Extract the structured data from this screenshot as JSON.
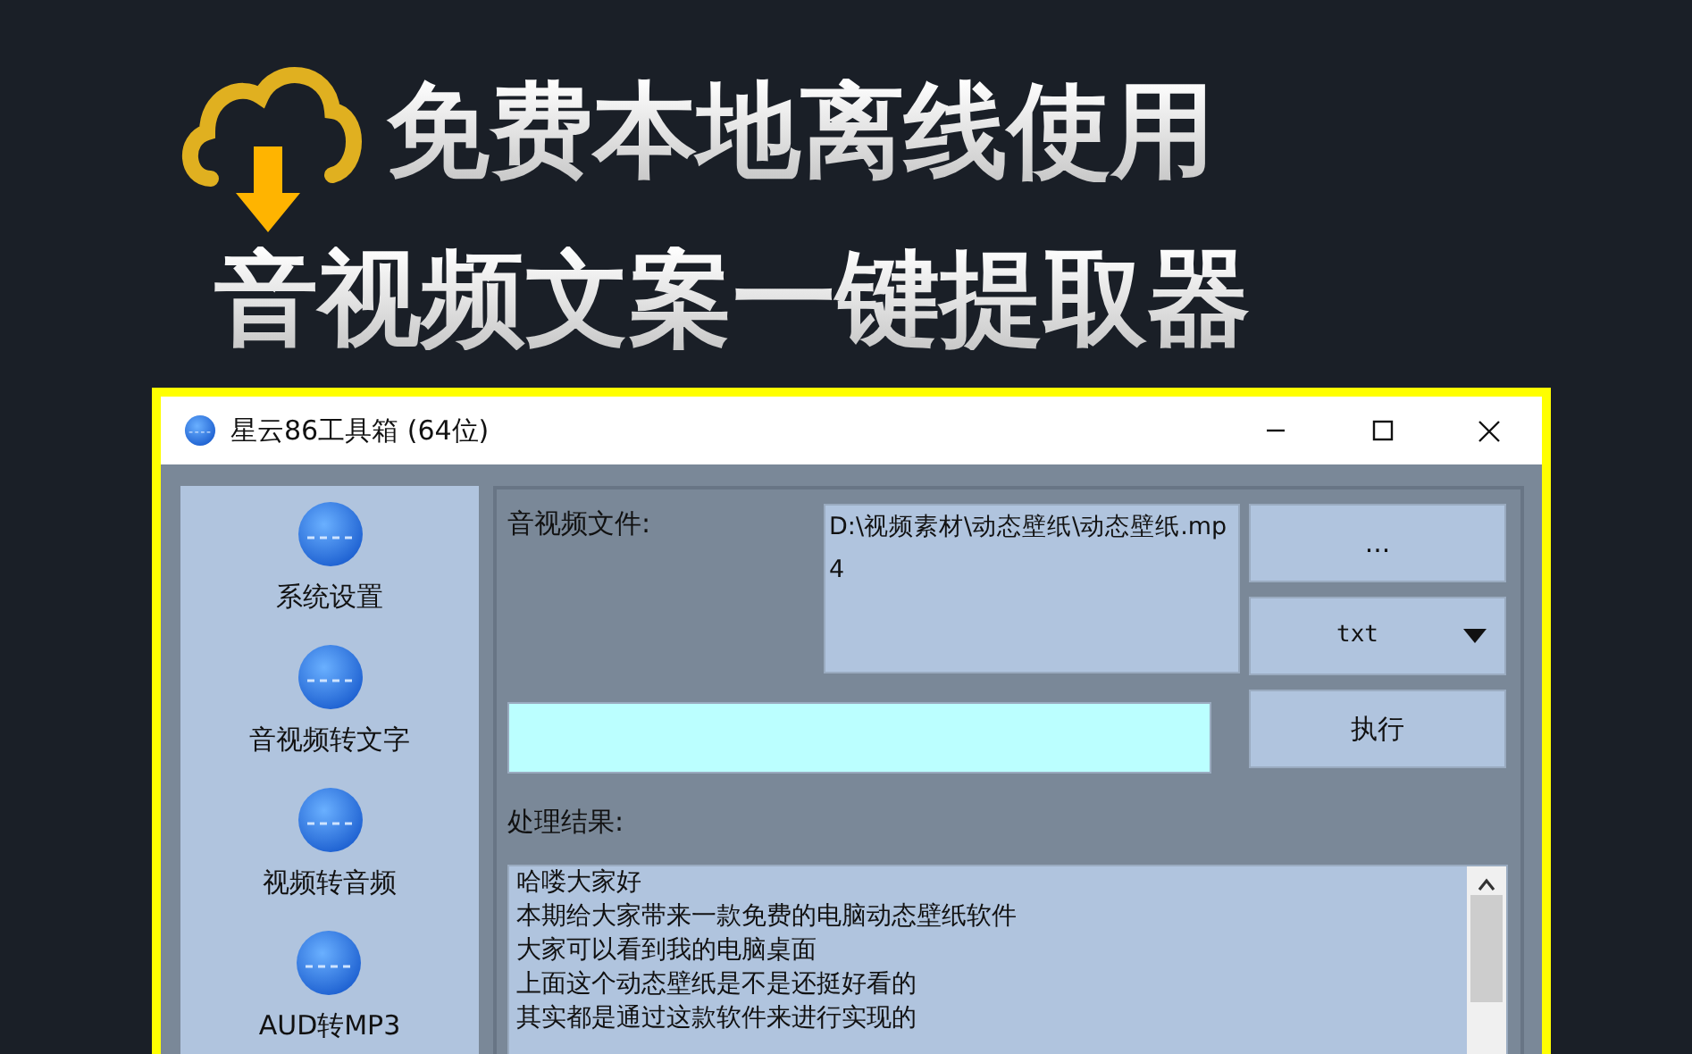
{
  "banner": {
    "headline_lines": [
      "免费本地离线使用",
      "音视频文案一键提取器"
    ]
  },
  "window": {
    "title": "星云86工具箱 (64位)"
  },
  "sidebar": {
    "items": [
      {
        "label": "系统设置"
      },
      {
        "label": "音视频转文字"
      },
      {
        "label": "视频转音频"
      },
      {
        "label": "AUD转MP3"
      }
    ]
  },
  "main": {
    "file_label": "音视频文件:",
    "file_path": "D:\\视频素材\\动态壁纸\\动态壁纸.mp4",
    "browse_button": "...",
    "format_select": "txt",
    "execute_button": "执行",
    "result_label": "处理结果:",
    "result_lines": [
      "哈喽大家好",
      "本期给大家带来一款免费的电脑动态壁纸软件",
      "大家可以看到我的电脑桌面",
      "上面这个动态壁纸是不是还挺好看的",
      "其实都是通过这款软件来进行实现的"
    ]
  }
}
